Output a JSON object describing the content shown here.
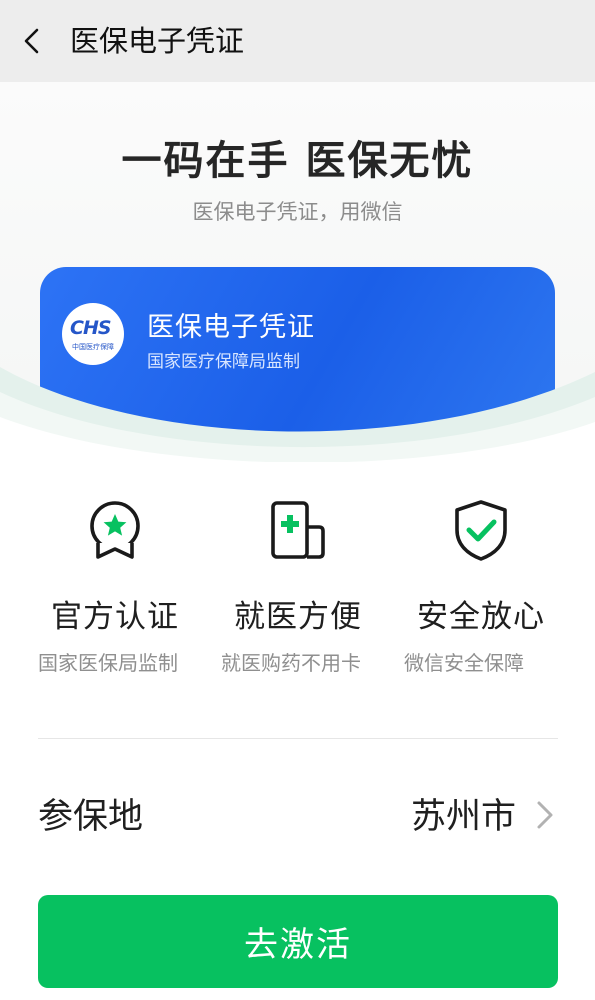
{
  "nav": {
    "title": "医保电子凭证",
    "icon": "back-arrow-icon"
  },
  "hero": {
    "headline": "一码在手 医保无忧",
    "subline": "医保电子凭证，用微信"
  },
  "card": {
    "logo_mark": "CHS",
    "logo_sub": "中国医疗保障",
    "title": "医保电子凭证",
    "subtitle": "国家医疗保障局监制",
    "color": "#1f63ea"
  },
  "features": [
    {
      "icon": "star-badge-icon",
      "title": "官方认证",
      "desc": "国家医保局监制"
    },
    {
      "icon": "medical-card-icon",
      "title": "就医方便",
      "desc": "就医购药不用卡"
    },
    {
      "icon": "shield-check-icon",
      "title": "安全放心",
      "desc": "微信安全保障"
    }
  ],
  "location": {
    "label": "参保地",
    "value": "苏州市",
    "icon": "chevron-right-icon"
  },
  "activate_button": {
    "label": "去激活",
    "color": "#07c160"
  },
  "colors": {
    "accent_green": "#07c160",
    "card_blue": "#1f63ea",
    "nav_bg": "#ededed"
  }
}
